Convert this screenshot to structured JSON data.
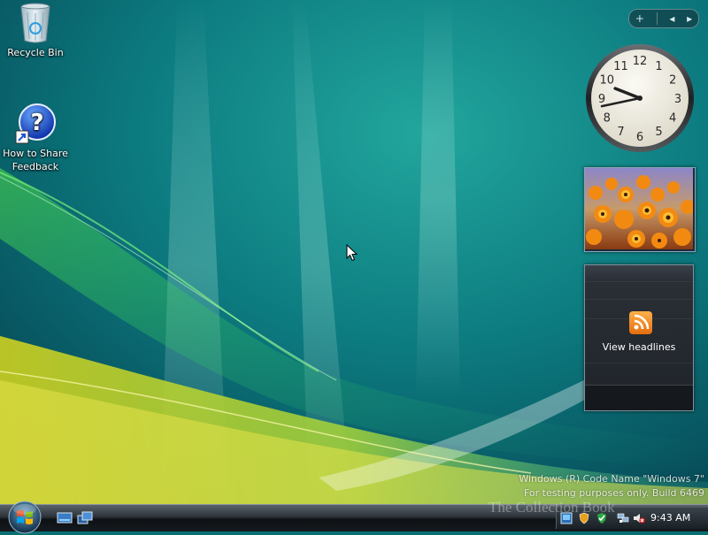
{
  "desktop": {
    "icons": [
      {
        "label": "Recycle Bin"
      },
      {
        "label": "How to Share Feedback"
      }
    ]
  },
  "sidebar": {
    "controls": {
      "add": "+",
      "prev": "◂",
      "next": "▸"
    },
    "clock": {
      "numerals": [
        "12",
        "1",
        "2",
        "3",
        "4",
        "5",
        "6",
        "7",
        "8",
        "9",
        "10",
        "11"
      ],
      "hour": 9,
      "minute": 43
    },
    "feed": {
      "label": "View headlines",
      "icon": "rss-feed-icon"
    }
  },
  "watermark": {
    "line1": "Windows (R) Code Name \"Windows 7\"",
    "line2": "For testing purposes only. Build 6469",
    "brand": "The Collection Book"
  },
  "taskbar": {
    "clock": "9:43 AM"
  },
  "colors": {
    "accent": "#1f9a8f",
    "taskbar": "#151a1e",
    "rss": "#f08a1c"
  }
}
